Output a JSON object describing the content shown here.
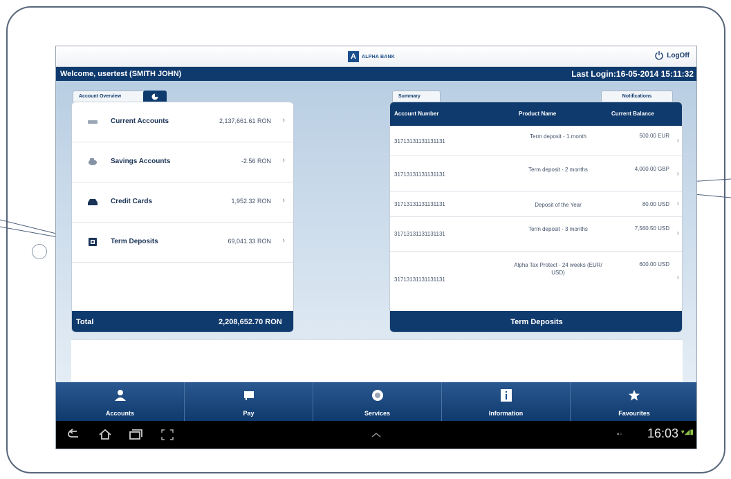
{
  "header": {
    "brand_mark": "A",
    "brand": "ALPHA BANK",
    "logoff": "LogOff",
    "welcome": "Welcome, usertest (SMITH JOHN)",
    "last_login": "Last Login:16-05-2014 15:11:32"
  },
  "left_panel": {
    "tab_overview": "Account Overview",
    "tab_pie_icon": "pie-chart-icon",
    "accounts": [
      {
        "name": "Current Accounts",
        "amount": "2,137,661.61 RON",
        "icon": "wallet-icon"
      },
      {
        "name": "Savings Accounts",
        "amount": "-2.56 RON",
        "icon": "piggy-bank-icon"
      },
      {
        "name": "Credit Cards",
        "amount": "1,952.32 RON",
        "icon": "credit-card-icon"
      },
      {
        "name": "Term Deposits",
        "amount": "69,041.33 RON",
        "icon": "deposit-icon"
      }
    ],
    "total_label": "Total",
    "total_value": "2,208,652.70 RON"
  },
  "right_panel": {
    "tab_summary": "Summary",
    "tab_notifications": "Notifications",
    "columns": [
      "Account Number",
      "Product Name",
      "Current Balance"
    ],
    "rows": [
      {
        "account": "31713131131131131",
        "product": "Term deposit - 1 month",
        "balance": "500.00 EUR"
      },
      {
        "account": "31713131131131131",
        "product": "Term deposit - 2 months",
        "balance": "4,000.00 GBP"
      },
      {
        "account": "31713131131131131",
        "product": "Deposit of the Year",
        "balance": "80.00 USD"
      },
      {
        "account": "31713131131131131",
        "product": "Term deposit - 3 months",
        "balance": "7,560.50 USD"
      },
      {
        "account": "31713131131131131",
        "product": "Alpha Tax Protect - 24 weeks (EUR/ USD)",
        "balance": "600.00 USD"
      }
    ],
    "footer": "Term Deposits"
  },
  "bottom_nav": [
    {
      "label": "Accounts",
      "icon": "user-icon"
    },
    {
      "label": "Pay",
      "icon": "pay-icon"
    },
    {
      "label": "Services",
      "icon": "services-icon"
    },
    {
      "label": "Information",
      "icon": "info-icon"
    },
    {
      "label": "Favourites",
      "icon": "star-icon"
    }
  ],
  "system_bar": {
    "clock": "16:03",
    "icons": [
      "back-icon",
      "home-icon",
      "recent-apps-icon",
      "screenshot-icon",
      "up-arrow-icon",
      "wifi-icon",
      "signal-icon",
      "battery-icon"
    ]
  },
  "colors": {
    "navy": "#0f3a6d",
    "accent": "#2a5890"
  }
}
